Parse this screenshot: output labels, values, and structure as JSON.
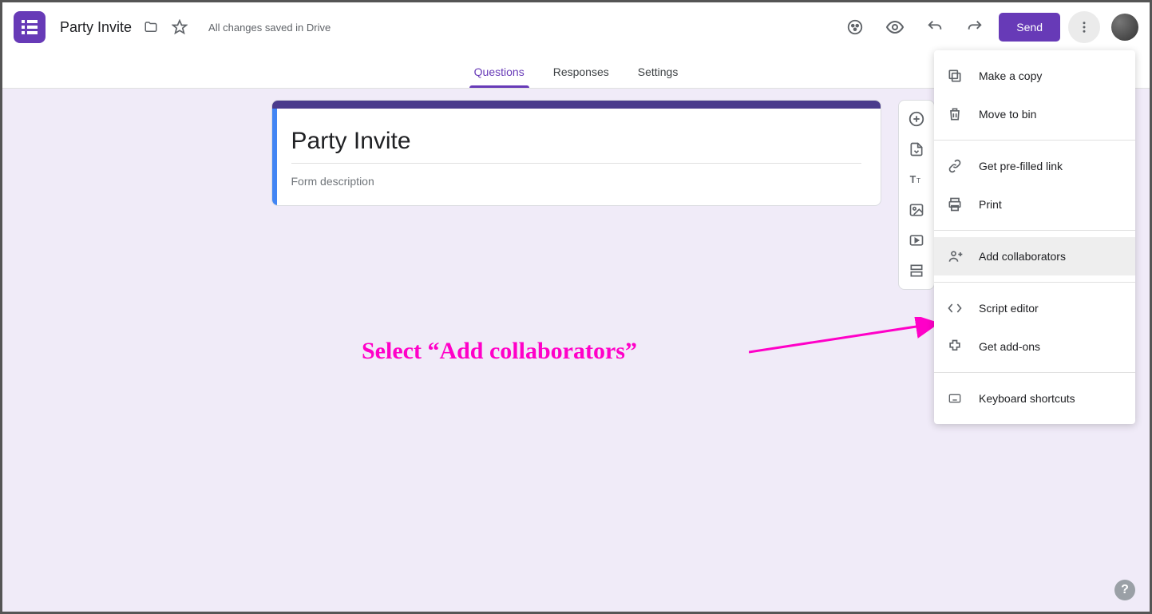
{
  "header": {
    "doc_title": "Party Invite",
    "save_status": "All changes saved in Drive",
    "send_label": "Send"
  },
  "tabs": {
    "questions": "Questions",
    "responses": "Responses",
    "settings": "Settings"
  },
  "form": {
    "title": "Party Invite",
    "description_placeholder": "Form description"
  },
  "menu": {
    "make_copy": "Make a copy",
    "move_bin": "Move to bin",
    "prefilled": "Get pre-filled link",
    "print": "Print",
    "add_collab": "Add collaborators",
    "script": "Script editor",
    "addons": "Get add-ons",
    "keyboard": "Keyboard shortcuts"
  },
  "annotation": {
    "text": "Select “Add collaborators”"
  }
}
